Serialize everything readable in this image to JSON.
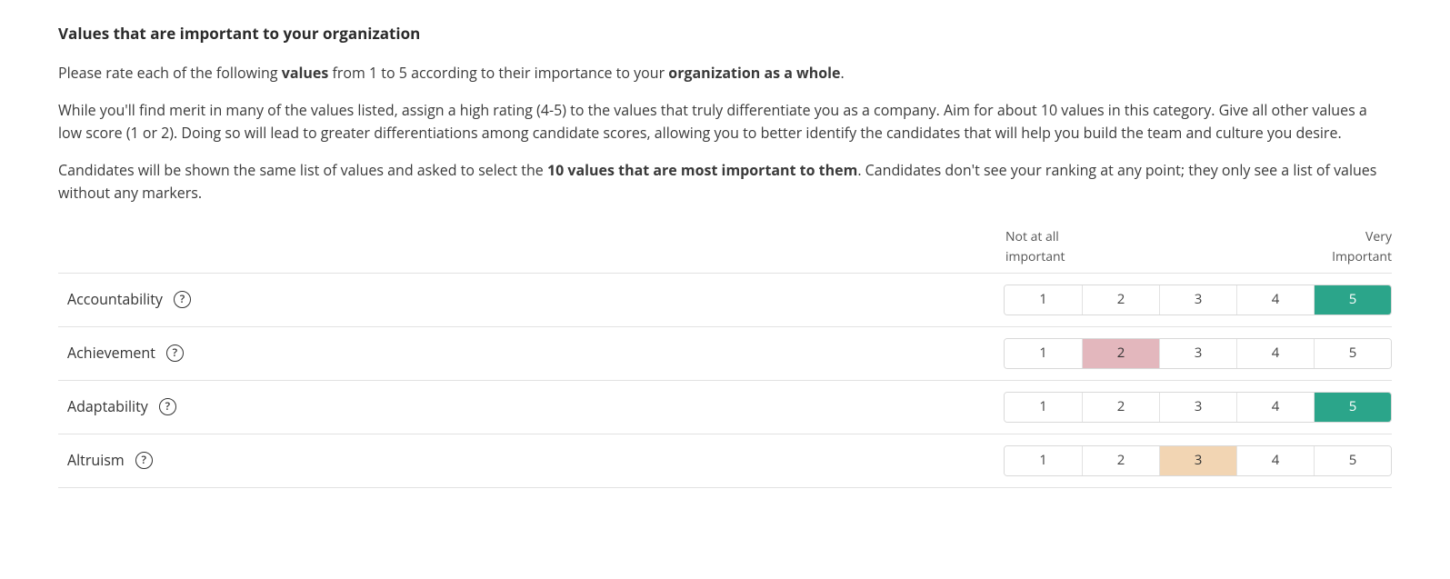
{
  "header": {
    "title": "Values that are important to your organization"
  },
  "intro": {
    "p1_a": "Please rate each of the following ",
    "p1_b": "values",
    "p1_c": " from 1 to 5 according to their importance to your ",
    "p1_d": "organization as a whole",
    "p1_e": ".",
    "p2": "While you'll find merit in many of the values listed, assign a high rating (4-5) to the values that truly differentiate you as a company. Aim for about 10 values in this category. Give all other values a low score (1 or 2). Doing so will lead to greater differentiations among candidate scores, allowing you to better identify the candidates that will help you build the team and culture you desire.",
    "p3_a": "Candidates will be shown the same list of values and asked to select the ",
    "p3_b": "10 values that are most important to them",
    "p3_c": ". Candidates don't see your ranking at any point; they only see a list of values without any markers."
  },
  "scale": {
    "low_label_line1": "Not at all",
    "low_label_line2": "important",
    "high_label_line1": "Very",
    "high_label_line2": "Important",
    "options": [
      "1",
      "2",
      "3",
      "4",
      "5"
    ]
  },
  "rows": [
    {
      "label": "Accountability",
      "selected": 5
    },
    {
      "label": "Achievement",
      "selected": 2
    },
    {
      "label": "Adaptability",
      "selected": 5
    },
    {
      "label": "Altruism",
      "selected": 3
    }
  ],
  "help_glyph": "?"
}
